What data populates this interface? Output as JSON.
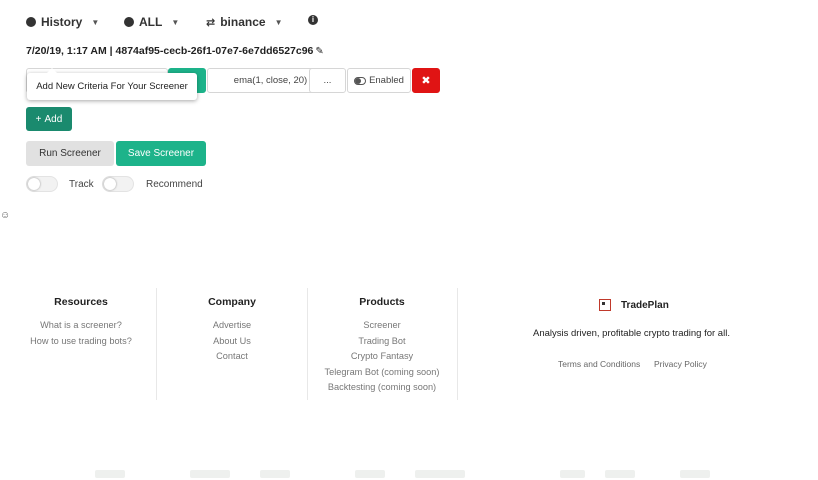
{
  "topbar": {
    "history_label": "History",
    "exchange_all_label": "ALL",
    "exchange_label": "binance"
  },
  "screener": {
    "id_text": "7/20/19, 1:17 AM | 4874af95-cecb-26f1-07e7-6e7dd6527c96"
  },
  "criteria": {
    "indicator_value": "ema(1, close, 20)",
    "more_label": "...",
    "enabled_label": "Enabled",
    "delete_label": "✖"
  },
  "tooltip": {
    "text": "Add New Criteria For Your Screener"
  },
  "actions": {
    "add_label": "Add",
    "run_label": "Run Screener",
    "save_label": "Save Screener"
  },
  "toggles": {
    "track_label": "Track",
    "recommend_label": "Recommend"
  },
  "footer": {
    "resources": {
      "title": "Resources",
      "links": [
        "What is a screener?",
        "How to use trading bots?"
      ]
    },
    "company": {
      "title": "Company",
      "links": [
        "Advertise",
        "About Us",
        "Contact"
      ]
    },
    "products": {
      "title": "Products",
      "links": [
        "Screener",
        "Trading Bot",
        "Crypto Fantasy",
        "Telegram Bot (coming soon)",
        "Backtesting (coming soon)"
      ]
    },
    "brand": {
      "name": "TradePlan",
      "tagline": "Analysis driven, profitable crypto trading for all.",
      "terms_label": "Terms and Conditions",
      "privacy_label": "Privacy Policy"
    }
  },
  "colors": {
    "accent": "#1db38a",
    "add_button": "#1a8a6e",
    "danger": "#e01414"
  },
  "icons": {
    "history": "clock-icon",
    "exchange_all": "dollar-icon",
    "exchange": "swap-icon",
    "info": "info-icon",
    "edit": "pencil-icon",
    "enabled": "toggle-icon",
    "brand": "tradeplan-logo-icon"
  }
}
